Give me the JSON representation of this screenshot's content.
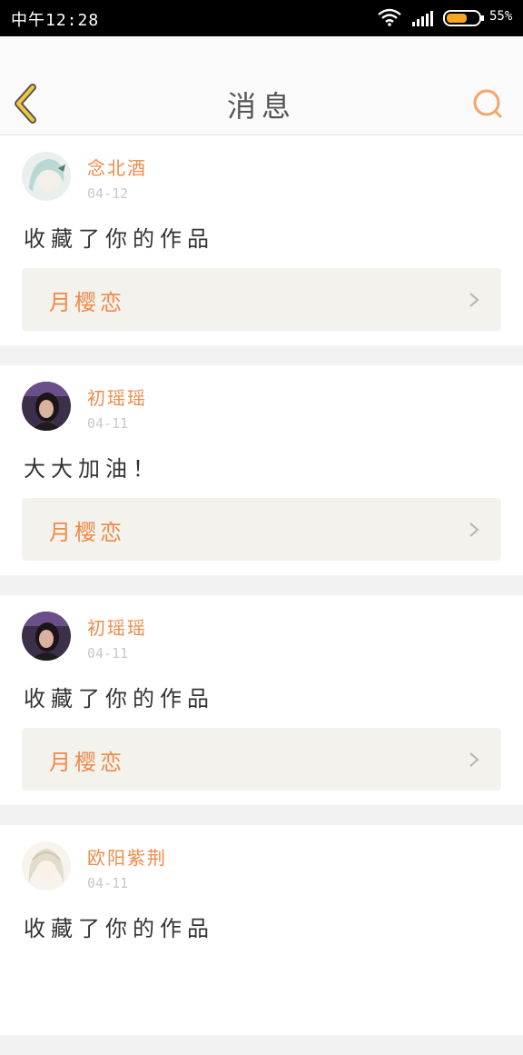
{
  "status_bar": {
    "time": "中午12:28",
    "battery_pct": "55%"
  },
  "header": {
    "title": "消息"
  },
  "colors": {
    "accent": "#ef8a4a",
    "card_bg": "#ffffff",
    "link_bg": "#f3f2ec"
  },
  "notifications": [
    {
      "user": "念北酒",
      "date": "04-12",
      "message": "收藏了你的作品",
      "work": "月樱恋",
      "avatar": "avatar-anime-white-hair"
    },
    {
      "user": "初瑶瑶",
      "date": "04-11",
      "message": "大大加油！",
      "work": "月樱恋",
      "avatar": "avatar-girl-photo"
    },
    {
      "user": "初瑶瑶",
      "date": "04-11",
      "message": "收藏了你的作品",
      "work": "月樱恋",
      "avatar": "avatar-girl-photo"
    },
    {
      "user": "欧阳紫荆",
      "date": "04-11",
      "message": "收藏了你的作品",
      "work": "",
      "avatar": "avatar-anime-girl"
    }
  ]
}
